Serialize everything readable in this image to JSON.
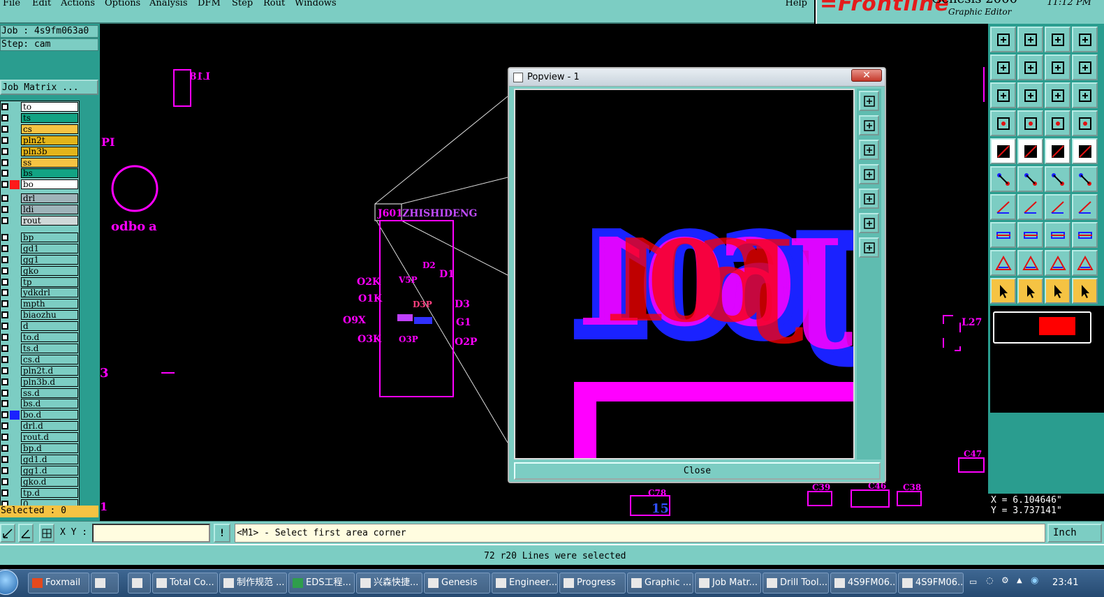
{
  "menubar": {
    "items": [
      "File",
      "Edit",
      "Actions",
      "Options",
      "Analysis",
      "DFM",
      "Step",
      "Rout",
      "Windows"
    ],
    "help": "Help"
  },
  "brand": {
    "logo": "Frontline",
    "product": "Genesis 2000",
    "subtitle": "Graphic Editor",
    "time": "11:12 PM"
  },
  "leftpanel": {
    "job": "Job : 4s9fm063a0",
    "step": "Step: cam",
    "job_matrix": "Job Matrix ...",
    "selected": "Selected : 0"
  },
  "layers": [
    {
      "name": "to",
      "bg": "#ffffff",
      "swatch": ""
    },
    {
      "name": "ts",
      "bg": "#12a383",
      "swatch": ""
    },
    {
      "name": "cs",
      "bg": "#f5c343",
      "swatch": ""
    },
    {
      "name": "pln2t",
      "bg": "#e2b41a",
      "swatch": ""
    },
    {
      "name": "pln3b",
      "bg": "#e2b41a",
      "swatch": ""
    },
    {
      "name": "ss",
      "bg": "#f5c343",
      "swatch": ""
    },
    {
      "name": "bs",
      "bg": "#12a383",
      "swatch": ""
    },
    {
      "name": "bo",
      "bg": "#ffffff",
      "swatch": "#ff1a1a"
    },
    {
      "name": "drl",
      "bg": "#9fb3b9",
      "swatch": ""
    },
    {
      "name": "ldi",
      "bg": "#9fb3b9",
      "swatch": ""
    },
    {
      "name": "rout",
      "bg": "#cfd8d8",
      "swatch": ""
    },
    {
      "name": "bp",
      "bg": "#7ccdc3",
      "swatch": ""
    },
    {
      "name": "gd1",
      "bg": "#7ccdc3",
      "swatch": ""
    },
    {
      "name": "gg1",
      "bg": "#7ccdc3",
      "swatch": ""
    },
    {
      "name": "gko",
      "bg": "#7ccdc3",
      "swatch": ""
    },
    {
      "name": "tp",
      "bg": "#7ccdc3",
      "swatch": ""
    },
    {
      "name": "ydkdrl",
      "bg": "#7ccdc3",
      "swatch": ""
    },
    {
      "name": "mpth",
      "bg": "#7ccdc3",
      "swatch": ""
    },
    {
      "name": "biaozhu",
      "bg": "#7ccdc3",
      "swatch": ""
    },
    {
      "name": "d",
      "bg": "#7ccdc3",
      "swatch": ""
    },
    {
      "name": "to.d",
      "bg": "#7ccdc3",
      "swatch": ""
    },
    {
      "name": "ts.d",
      "bg": "#7ccdc3",
      "swatch": ""
    },
    {
      "name": "cs.d",
      "bg": "#7ccdc3",
      "swatch": ""
    },
    {
      "name": "pln2t.d",
      "bg": "#7ccdc3",
      "swatch": ""
    },
    {
      "name": "pln3b.d",
      "bg": "#7ccdc3",
      "swatch": ""
    },
    {
      "name": "ss.d",
      "bg": "#7ccdc3",
      "swatch": ""
    },
    {
      "name": "bs.d",
      "bg": "#7ccdc3",
      "swatch": ""
    },
    {
      "name": "bo.d",
      "bg": "#7ccdc3",
      "swatch": "#1a22ff"
    },
    {
      "name": "drl.d",
      "bg": "#7ccdc3",
      "swatch": ""
    },
    {
      "name": "rout.d",
      "bg": "#7ccdc3",
      "swatch": ""
    },
    {
      "name": "bp.d",
      "bg": "#7ccdc3",
      "swatch": ""
    },
    {
      "name": "gd1.d",
      "bg": "#7ccdc3",
      "swatch": ""
    },
    {
      "name": "gg1.d",
      "bg": "#7ccdc3",
      "swatch": ""
    },
    {
      "name": "gko.d",
      "bg": "#7ccdc3",
      "swatch": ""
    },
    {
      "name": "tp.d",
      "bg": "#7ccdc3",
      "swatch": ""
    },
    {
      "name": "0",
      "bg": "#7ccdc3",
      "swatch": ""
    }
  ],
  "canvas": {
    "labels": {
      "l18": "L18",
      "pi": "PI",
      "odbo": "odbo",
      "a": "a",
      "zhishideng": "ZHISHIDENG",
      "j601": "J601",
      "d2": "D2",
      "d1": "D1",
      "o2k": "O2K",
      "o1k": "O1K",
      "o9x": "O9X",
      "o3k": "O3K",
      "d3": "D3",
      "g1": "G1",
      "o2p": "O2P",
      "v5p": "V5P",
      "d3p": "D3P",
      "o3p": "O3P",
      "l27": "L27",
      "c47": "C47",
      "c78": "C78",
      "n15": "15",
      "c38": "C38",
      "c39": "C39",
      "c46": "C46",
      "n1": "1",
      "n3": "3"
    }
  },
  "popview": {
    "title": "Popview - 1",
    "preview_text": "J601",
    "close_label": "Close"
  },
  "rightpanel": {
    "coord_x": "X = 6.104646\"",
    "coord_y": "Y = 3.737141\""
  },
  "bottombar": {
    "xy_label": "X Y :",
    "xy_value": "",
    "prompt": "<M1> - Select first area corner",
    "unit": "Inch"
  },
  "status": "72 r20 Lines were selected",
  "taskbar": {
    "items": [
      "Foxmail",
      "",
      "",
      "Total Co...",
      "制作规范 ...",
      "EDS工程...",
      "兴森快捷...",
      "Genesis",
      "Engineer...",
      "Progress",
      "Graphic ...",
      "Job Matr...",
      "Drill Tool...",
      "4S9FM06...",
      "4S9FM06..."
    ],
    "clock": "23:41"
  }
}
